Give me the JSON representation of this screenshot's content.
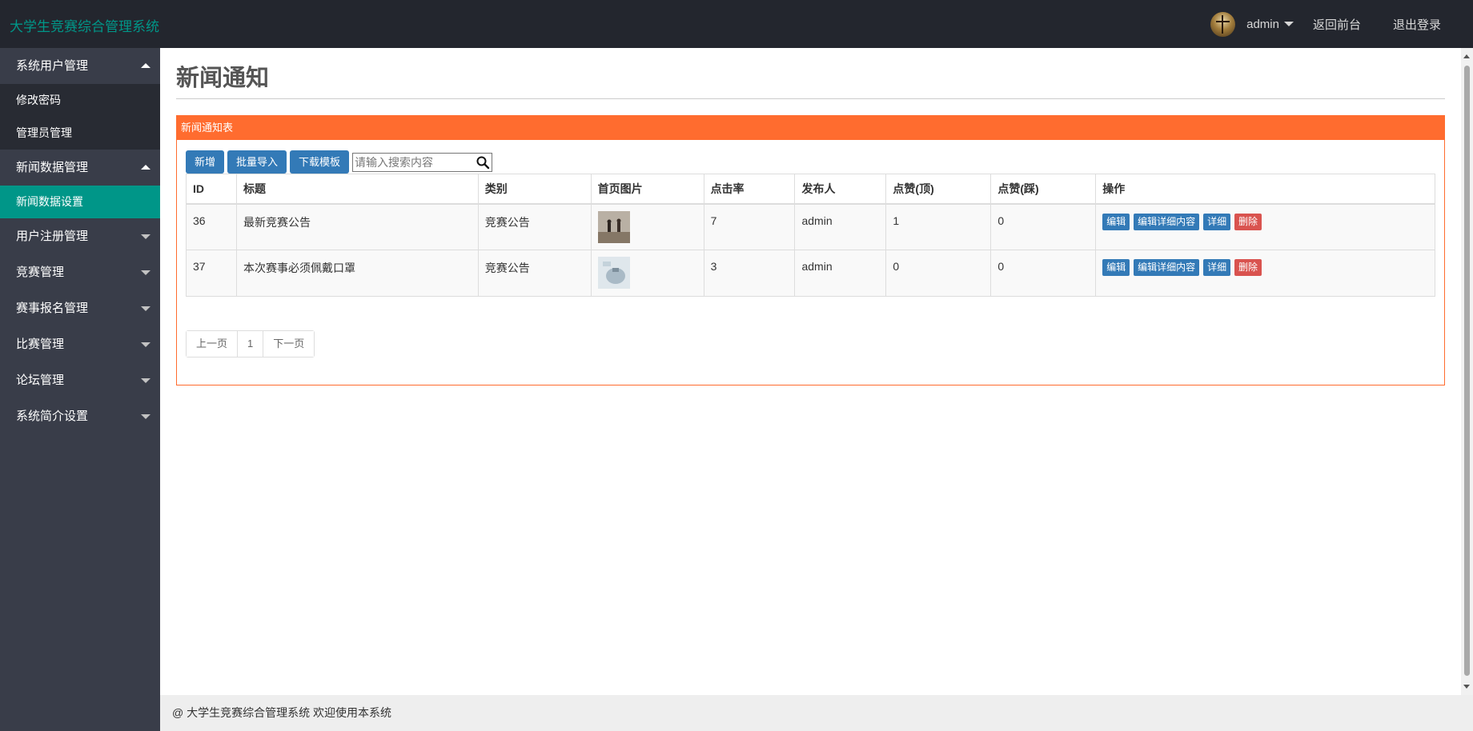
{
  "app": {
    "title": "大学生竞赛综合管理系统"
  },
  "header": {
    "user_name": "admin",
    "back_label": "返回前台",
    "logout_label": "退出登录"
  },
  "sidebar": {
    "groups": [
      {
        "label": "系统用户管理",
        "expanded": true,
        "items": [
          {
            "label": "修改密码"
          },
          {
            "label": "管理员管理"
          }
        ]
      },
      {
        "label": "新闻数据管理",
        "expanded": true,
        "items": [
          {
            "label": "新闻数据设置",
            "active": true
          }
        ]
      },
      {
        "label": "用户注册管理",
        "expanded": false
      },
      {
        "label": "竞赛管理",
        "expanded": false
      },
      {
        "label": "赛事报名管理",
        "expanded": false
      },
      {
        "label": "比赛管理",
        "expanded": false
      },
      {
        "label": "论坛管理",
        "expanded": false
      },
      {
        "label": "系统简介设置",
        "expanded": false
      }
    ]
  },
  "main": {
    "page_title": "新闻通知",
    "panel_title": "新闻通知表",
    "toolbar": {
      "add_label": "新增",
      "import_label": "批量导入",
      "template_label": "下载模板",
      "search_placeholder": "请输入搜索内容"
    },
    "table": {
      "columns": [
        "ID",
        "标题",
        "类别",
        "首页图片",
        "点击率",
        "发布人",
        "点赞(顶)",
        "点赞(踩)",
        "操作"
      ],
      "rows": [
        {
          "id": "36",
          "title": "最新竞赛公告",
          "category": "竞赛公告",
          "clicks": "7",
          "publisher": "admin",
          "likes": "1",
          "dislikes": "0"
        },
        {
          "id": "37",
          "title": "本次赛事必须佩戴口罩",
          "category": "竞赛公告",
          "clicks": "3",
          "publisher": "admin",
          "likes": "0",
          "dislikes": "0"
        }
      ],
      "actions": {
        "edit": "编辑",
        "edit_detail": "编辑详细内容",
        "detail": "详细",
        "delete": "删除"
      }
    },
    "pager": {
      "prev": "上一页",
      "current": "1",
      "next": "下一页"
    }
  },
  "footer": {
    "text": "@ 大学生竞赛综合管理系统 欢迎使用本系统"
  },
  "colors": {
    "topbar": "#23262e",
    "sidebar": "#393d49",
    "accent_green": "#009688",
    "panel_orange": "#ff6c2f",
    "button_blue": "#337ab7",
    "delete_red": "#d9534f"
  }
}
